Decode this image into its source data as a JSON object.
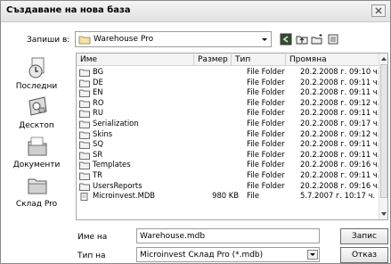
{
  "dialog": {
    "title": "Създаване на нова база",
    "close_glyph": "✕"
  },
  "lookin": {
    "label": "Запиши в:",
    "value": "Warehouse Pro"
  },
  "toolbar": [
    "back-icon",
    "up-folder-icon",
    "new-folder-icon",
    "view-menu-icon"
  ],
  "places": [
    {
      "label": "Последни",
      "icon": "recent-icon"
    },
    {
      "label": "Десктоп",
      "icon": "desktop-icon"
    },
    {
      "label": "Документи",
      "icon": "documents-icon"
    },
    {
      "label": "Склад Pro",
      "icon": "folder-icon"
    }
  ],
  "columns": {
    "name": "Име",
    "size": "Размер",
    "type": "Тип",
    "modified": "Промяна"
  },
  "files": [
    {
      "name": "BG",
      "size": "",
      "type": "File Folder",
      "modified": "20.2.2008 г. 09:10 ч."
    },
    {
      "name": "DE",
      "size": "",
      "type": "File Folder",
      "modified": "20.2.2008 г. 09:11 ч."
    },
    {
      "name": "EN",
      "size": "",
      "type": "File Folder",
      "modified": "20.2.2008 г. 09:11 ч."
    },
    {
      "name": "RO",
      "size": "",
      "type": "File Folder",
      "modified": "20.2.2008 г. 09:12 ч."
    },
    {
      "name": "RU",
      "size": "",
      "type": "File Folder",
      "modified": "20.2.2008 г. 09:11 ч."
    },
    {
      "name": "Serialization",
      "size": "",
      "type": "File Folder",
      "modified": "20.2.2008 г. 09:17 ч."
    },
    {
      "name": "Skins",
      "size": "",
      "type": "File Folder",
      "modified": "20.2.2008 г. 09:12 ч."
    },
    {
      "name": "SQ",
      "size": "",
      "type": "File Folder",
      "modified": "20.2.2008 г. 09:11 ч."
    },
    {
      "name": "SR",
      "size": "",
      "type": "File Folder",
      "modified": "20.2.2008 г. 09:11 ч."
    },
    {
      "name": "Templates",
      "size": "",
      "type": "File Folder",
      "modified": "20.2.2008 г. 09:16 ч."
    },
    {
      "name": "TR",
      "size": "",
      "type": "File Folder",
      "modified": "20.2.2008 г. 09:11 ч."
    },
    {
      "name": "UsersReports",
      "size": "",
      "type": "File Folder",
      "modified": "20.2.2008 г. 09:16 ч."
    },
    {
      "name": "Microinvest.MDB",
      "size": "980 KB",
      "type": "File",
      "modified": "5.7.2007 г. 10:17 ч."
    }
  ],
  "filename": {
    "label": "Име на",
    "value": "Warehouse.mdb"
  },
  "filetype": {
    "label": "Тип на",
    "value": "Microinvest Склад Pro (*.mdb)"
  },
  "buttons": {
    "open": "Запис",
    "cancel": "Отказ"
  }
}
